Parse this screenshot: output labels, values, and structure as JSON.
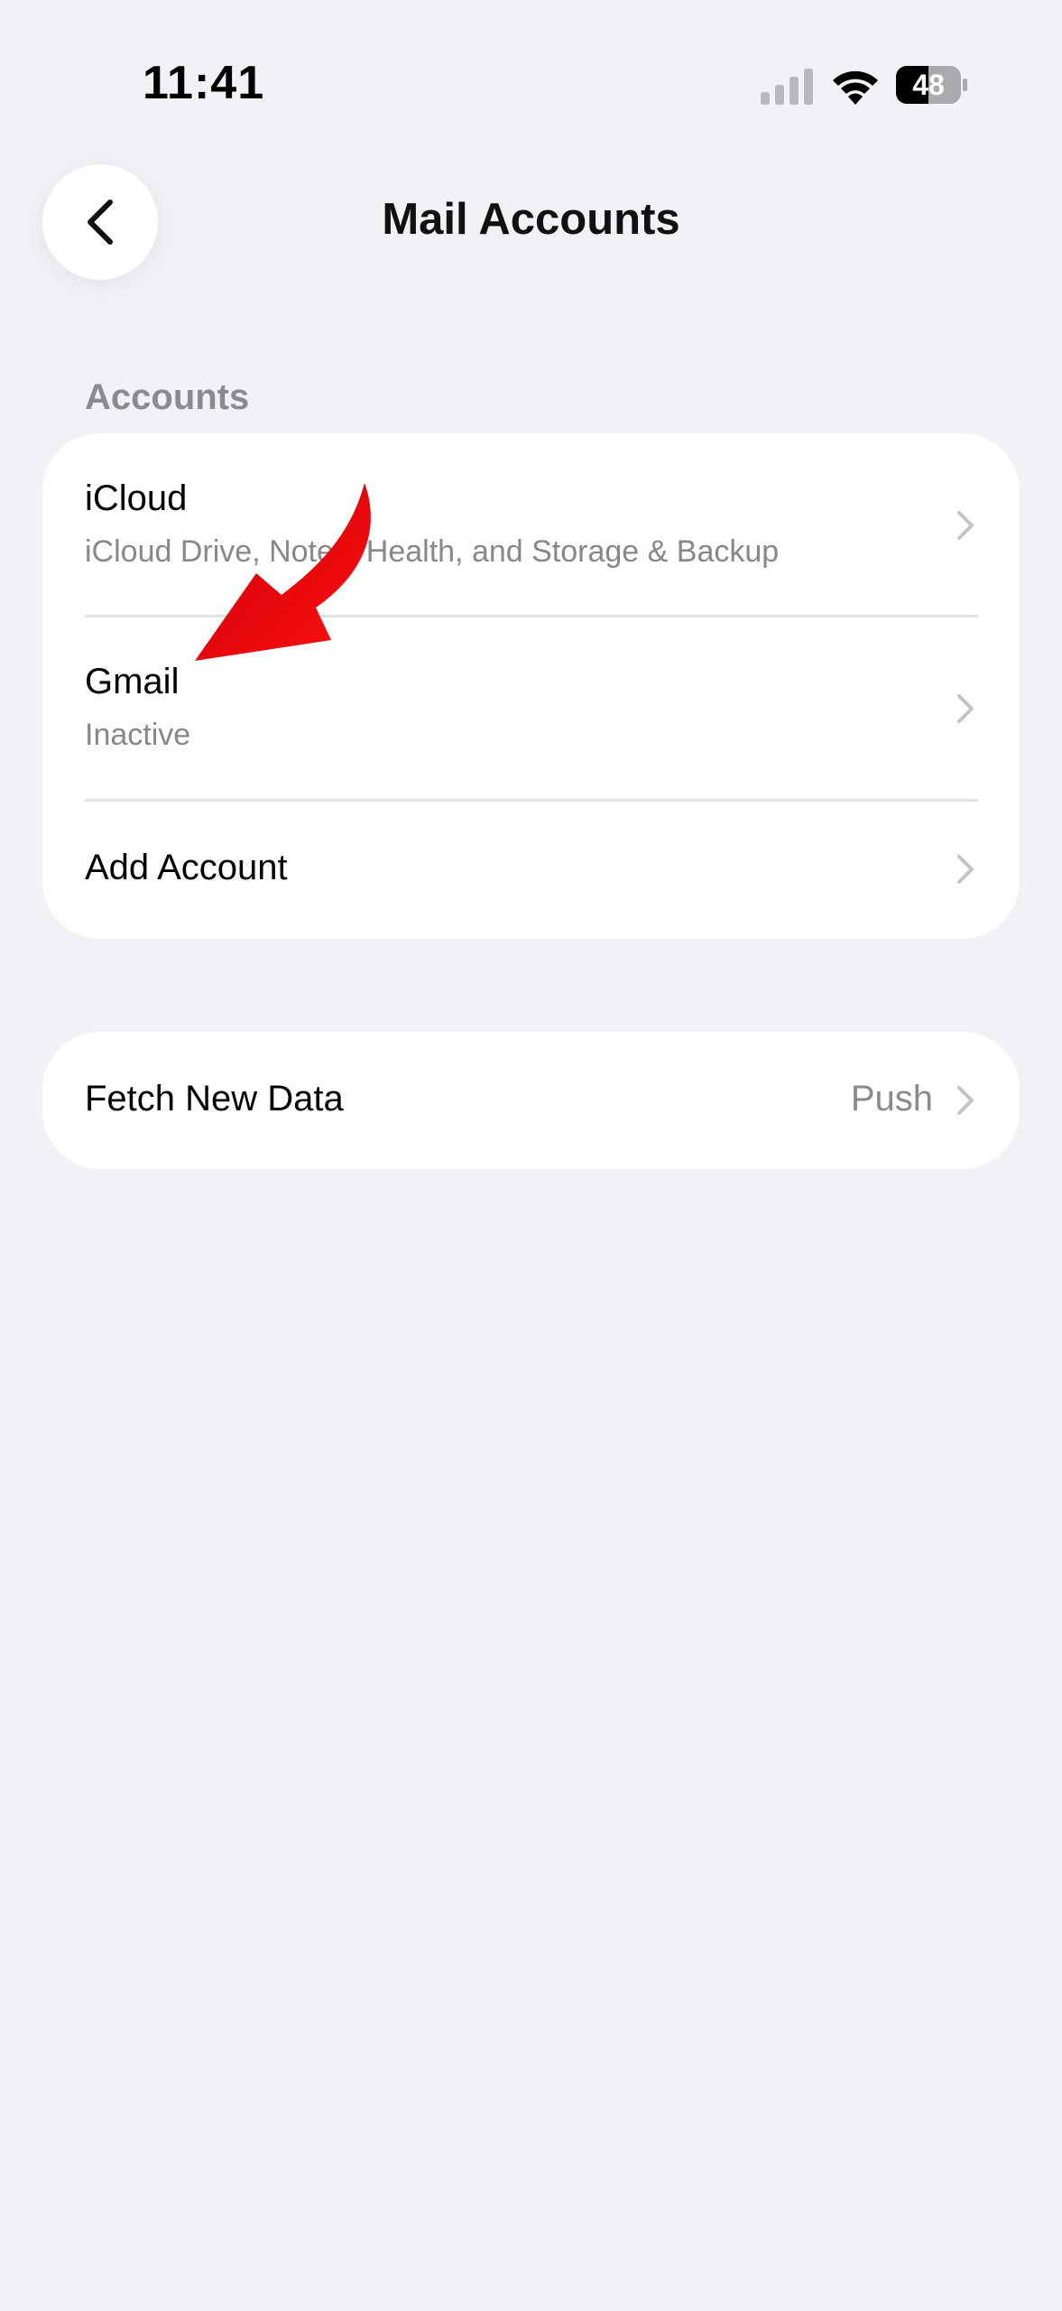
{
  "status_bar": {
    "time": "11:41",
    "battery": "48",
    "signal_icon": "cellular-signal-icon",
    "wifi_icon": "wifi-icon",
    "battery_icon": "battery-icon"
  },
  "nav": {
    "title": "Mail Accounts",
    "back_icon": "chevron-left-icon"
  },
  "accounts_section": {
    "header": "Accounts",
    "rows": [
      {
        "title": "iCloud",
        "subtitle": "iCloud Drive, Notes, Health, and Storage & Backup"
      },
      {
        "title": "Gmail",
        "subtitle": "Inactive"
      },
      {
        "title": "Add Account"
      }
    ]
  },
  "fetch_section": {
    "title": "Fetch New Data",
    "value": "Push"
  },
  "annotation": {
    "icon": "red-arrow-icon",
    "color": "#e8000b"
  },
  "colors": {
    "background": "#f1f2f6",
    "card": "#ffffff",
    "secondary_text": "#87878c",
    "chevron": "#c4c4c7"
  }
}
